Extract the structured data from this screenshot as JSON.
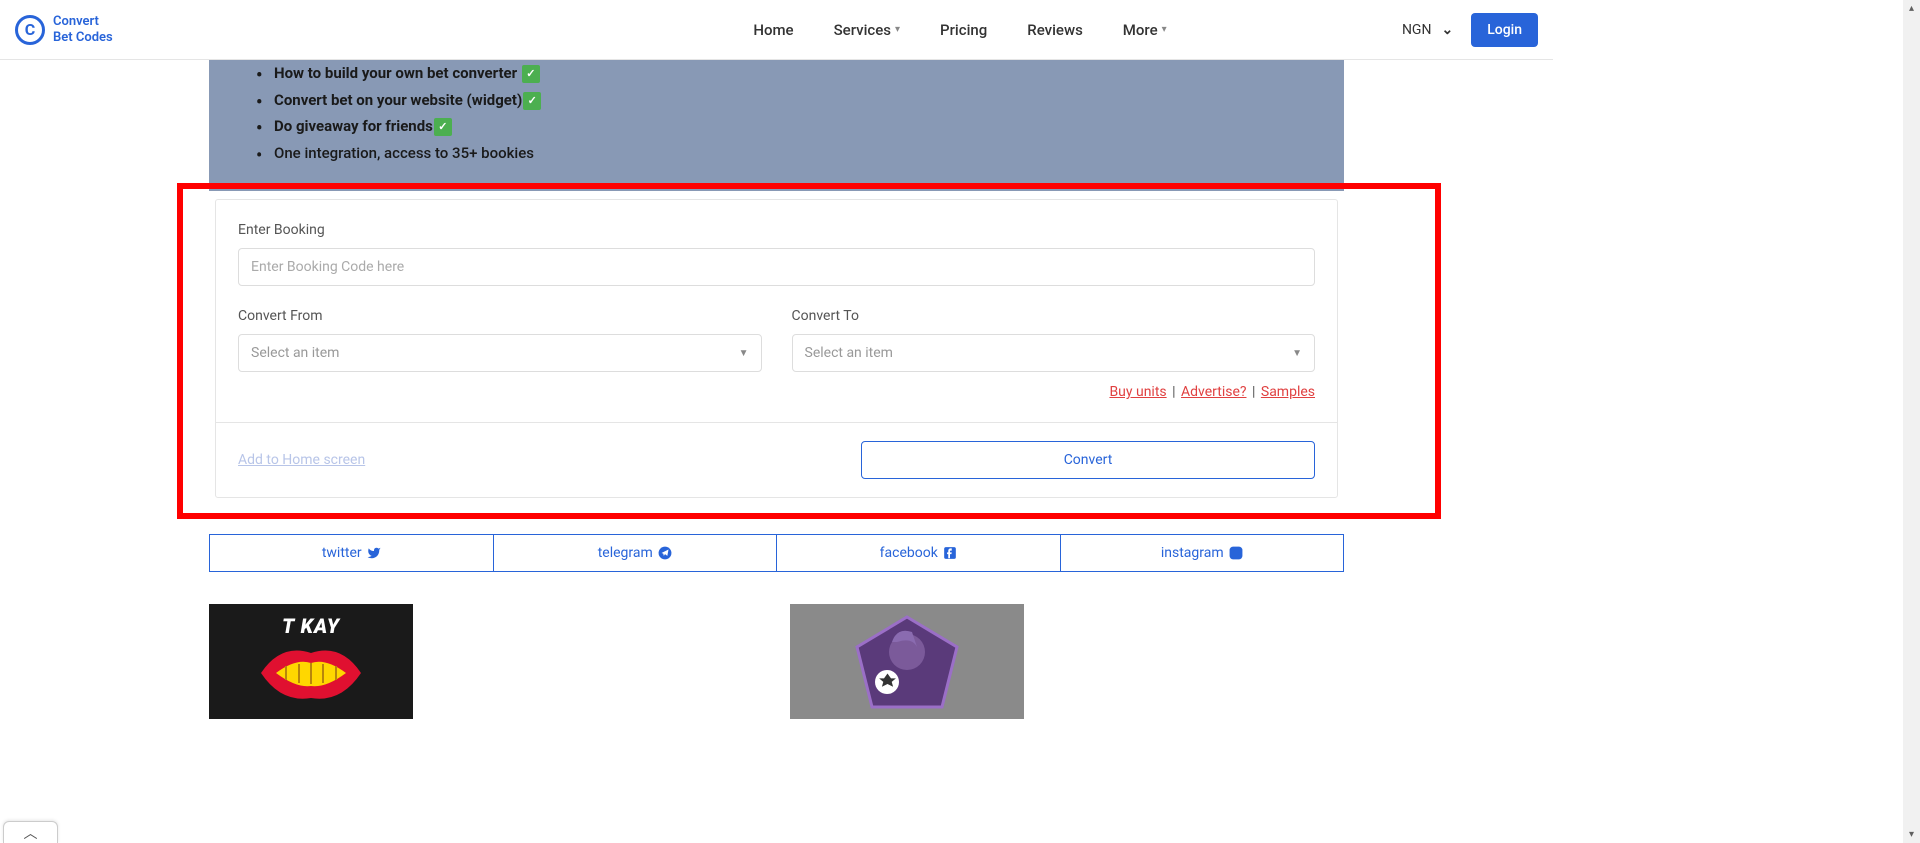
{
  "header": {
    "logo": {
      "icon_letter": "C",
      "line1": "Convert",
      "line2": "Bet Codes"
    },
    "nav": {
      "home": "Home",
      "services": "Services",
      "pricing": "Pricing",
      "reviews": "Reviews",
      "more": "More"
    },
    "currency": "NGN",
    "login": "Login"
  },
  "promo": {
    "item1": "How to build your own bet converter",
    "item2": "Convert bet on your website (widget)",
    "item3": "Do giveaway for friends",
    "item4": "One integration, access to 35+ bookies"
  },
  "form": {
    "booking_label": "Enter Booking",
    "booking_placeholder": "Enter Booking Code here",
    "from_label": "Convert From",
    "to_label": "Convert To",
    "select_placeholder": "Select an item",
    "buy_units": "Buy units",
    "advertise": "Advertise?",
    "samples": "Samples",
    "add_home": "Add to Home screen",
    "convert": "Convert"
  },
  "social": {
    "twitter": "twitter",
    "telegram": "telegram",
    "facebook": "facebook",
    "instagram": "instagram"
  },
  "tiles": {
    "tkay": "T KAY"
  }
}
